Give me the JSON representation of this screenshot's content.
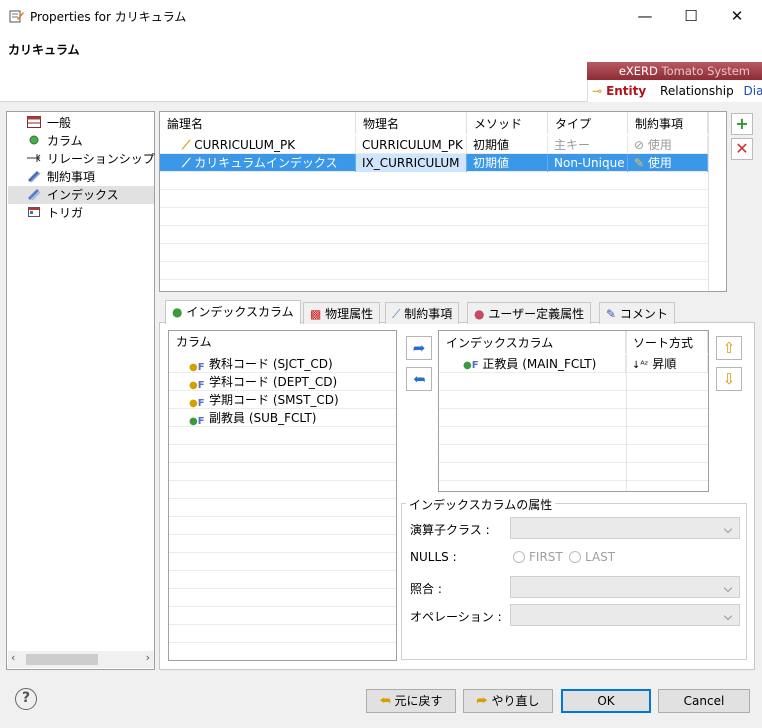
{
  "window": {
    "title": "Properties for カリキュラム",
    "minimize": "—",
    "maximize": "☐",
    "close": "✕"
  },
  "header": {
    "title": "カリキュラム"
  },
  "exerd": {
    "brand": "eXERD",
    "subtitle": "Tomato System",
    "tabs": [
      "Entity",
      "Relationship",
      "Diag"
    ]
  },
  "tree": {
    "items": [
      {
        "label": "一般",
        "icon": "table-icon"
      },
      {
        "label": "カラム",
        "icon": "column-dot-icon"
      },
      {
        "label": "リレーションシップ",
        "icon": "relation-arrow-icon"
      },
      {
        "label": "制約事項",
        "icon": "constraint-icon"
      },
      {
        "label": "インデックス",
        "icon": "index-icon"
      },
      {
        "label": "トリガ",
        "icon": "trigger-icon"
      }
    ],
    "selected_index": 4
  },
  "index_table": {
    "headers": [
      "論理名",
      "物理名",
      "メソッド",
      "タイプ",
      "制約事項"
    ],
    "rows": [
      {
        "logical": "CURRICULUM_PK",
        "physical": "CURRICULUM_PK",
        "method": "初期値",
        "type": "主キー",
        "constraint": "使用"
      },
      {
        "logical": "カリキュラムインデックス",
        "physical": "IX_CURRICULUM",
        "method": "初期値",
        "type": "Non-Unique",
        "constraint": "使用"
      }
    ],
    "selected_row": 1,
    "add_icon": "plus-icon",
    "delete_icon": "delete-x-icon"
  },
  "tabs": [
    {
      "label": "インデックスカラム",
      "icon": "index-column-icon"
    },
    {
      "label": "物理属性",
      "icon": "physical-attr-icon"
    },
    {
      "label": "制約事項",
      "icon": "constraint-icon"
    },
    {
      "label": "ユーザー定義属性",
      "icon": "user-attr-icon"
    },
    {
      "label": "コメント",
      "icon": "comment-icon"
    }
  ],
  "active_tab": 0,
  "column_list": {
    "header": "カラム",
    "items": [
      {
        "label": "教科コード (SJCT_CD)",
        "kind": "pk-fk"
      },
      {
        "label": "学科コード (DEPT_CD)",
        "kind": "pk-fk"
      },
      {
        "label": "学期コード (SMST_CD)",
        "kind": "pk-fk"
      },
      {
        "label": "副教員 (SUB_FCLT)",
        "kind": "fk"
      }
    ]
  },
  "index_columns": {
    "headers": [
      "インデックスカラム",
      "ソート方式"
    ],
    "rows": [
      {
        "column": "正教員 (MAIN_FCLT)",
        "sort": "昇順"
      }
    ]
  },
  "attributes": {
    "legend": "インデックスカラムの属性",
    "operator_class_label": "演算子クラス :",
    "nulls_label": "NULLS :",
    "nulls_first": "FIRST",
    "nulls_last": "LAST",
    "collation_label": "照合 :",
    "operation_label": "オペレーション :"
  },
  "footer": {
    "restore_label": "元に戻す",
    "redo_label": "やり直し",
    "ok_label": "OK",
    "cancel_label": "Cancel",
    "help": "?"
  }
}
